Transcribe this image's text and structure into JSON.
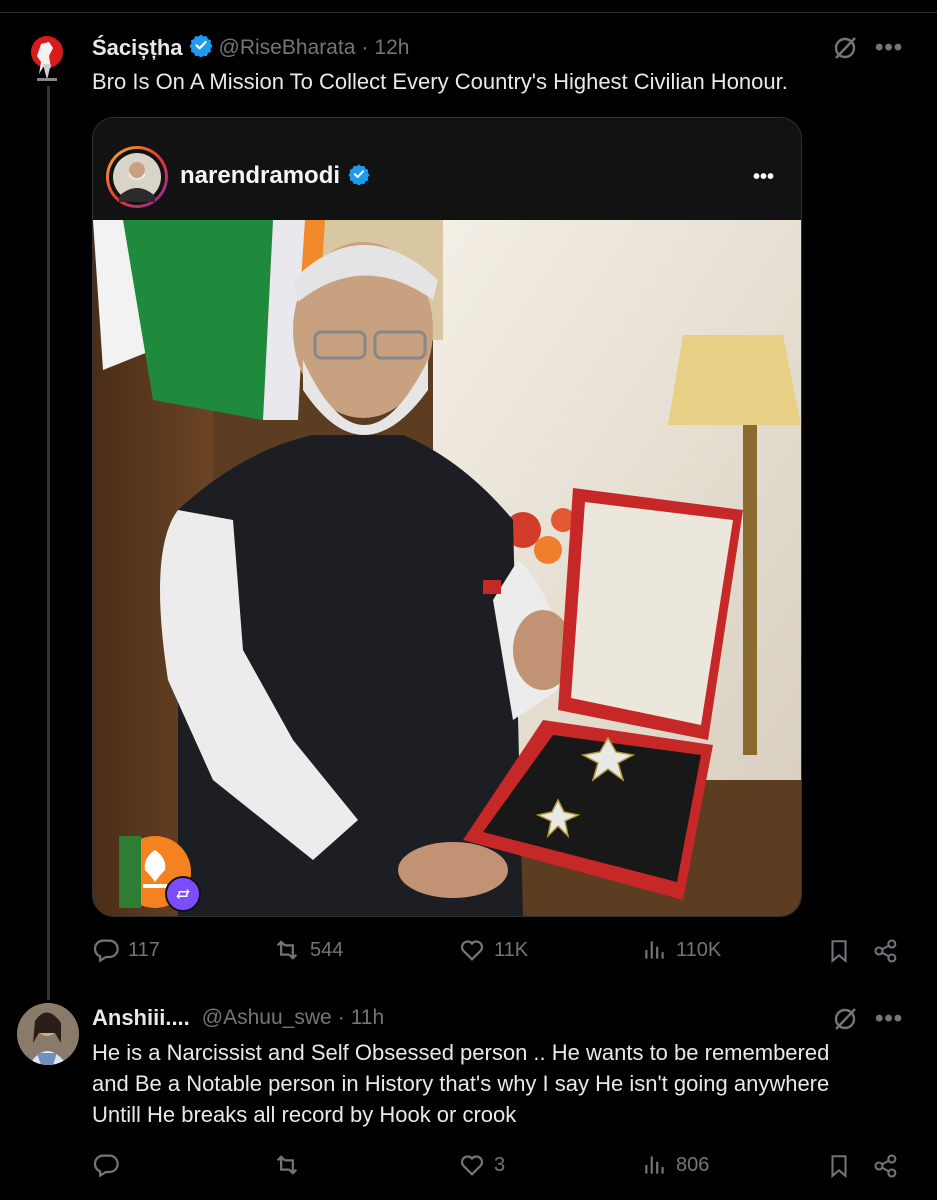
{
  "tweet1": {
    "display_name": "Śacișțha",
    "handle": "@RiseBharata",
    "separator": "·",
    "time": "12h",
    "text": "Bro Is On A Mission To Collect Every Country's Highest Civilian Honour.",
    "embed": {
      "account_name": "narendramodi",
      "more_label": "•••"
    },
    "stats": {
      "replies": "117",
      "reposts": "544",
      "likes": "11K",
      "views": "110K"
    }
  },
  "tweet2": {
    "display_name": "Anshiii....",
    "handle": "@Ashuu_swe",
    "separator": "·",
    "time": "11h",
    "text_lines": [
      "He is a Narcissist and Self Obsessed person .. He wants to be remembered",
      "and Be a Notable person in History that's why I say He isn't going anywhere",
      "Untill He breaks all record by Hook or crook"
    ],
    "stats": {
      "replies": "",
      "reposts": "",
      "likes": "3",
      "views": "806"
    }
  },
  "more_label": "•••",
  "colors": {
    "background": "#000000",
    "text": "#e7e9ea",
    "muted": "#71767b",
    "verified": "#1d9bf0",
    "border": "#2f3336"
  }
}
